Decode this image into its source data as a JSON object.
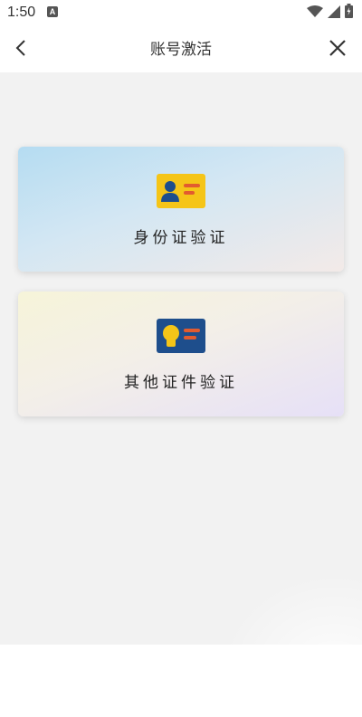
{
  "status_bar": {
    "time": "1:50",
    "notification_glyph": "A",
    "icons": [
      "wifi-icon",
      "cell-signal-icon",
      "battery-icon"
    ]
  },
  "nav": {
    "title": "账号激活",
    "back_icon": "chevron-left-icon",
    "close_icon": "close-icon"
  },
  "cards": [
    {
      "label": "身份证验证",
      "icon": "id-card-icon",
      "icon_color": "#f5c518"
    },
    {
      "label": "其他证件验证",
      "icon": "document-card-icon",
      "icon_color": "#1e4e8c"
    }
  ],
  "colors": {
    "page_background": "#f2f2f2",
    "id_card_yellow": "#f5c518",
    "id_card_person": "#1e4e8c",
    "id_card_lines": "#e25b2f",
    "doc_card_blue": "#1e4e8c",
    "doc_card_person": "#f5c518"
  }
}
